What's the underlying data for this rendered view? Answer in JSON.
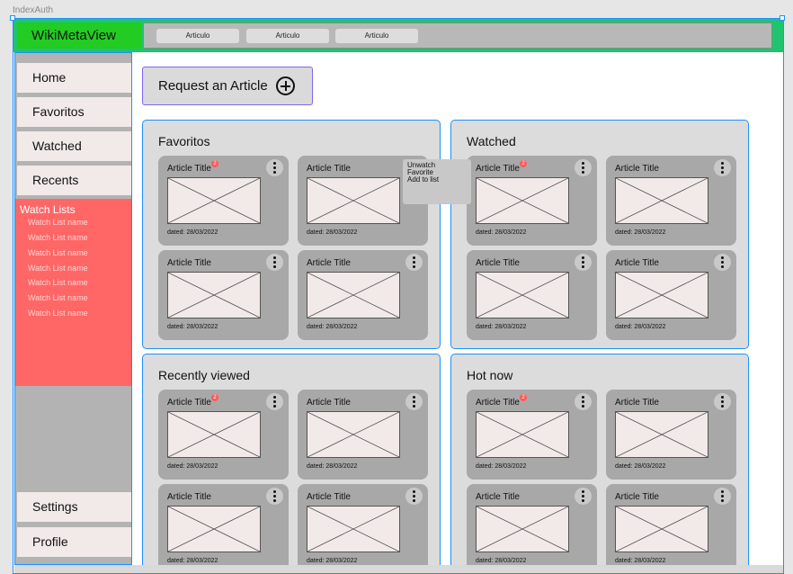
{
  "frame_label": "IndexAuth",
  "header": {
    "brand": "WikiMetaView",
    "tabs": [
      "Articulo",
      "Articulo",
      "Articulo"
    ]
  },
  "sidebar": {
    "nav": [
      "Home",
      "Favoritos",
      "Watched",
      "Recents"
    ],
    "watchlists": {
      "title": "Watch Lists",
      "items": [
        "Watch List name",
        "Watch List name",
        "Watch List name",
        "Watch List name",
        "Watch List name",
        "Watch List name",
        "Watch List name"
      ]
    },
    "bottom": [
      "Settings",
      "Profile"
    ]
  },
  "request_button": {
    "label": "Request an Article",
    "icon": "plus-circle-icon"
  },
  "sections": [
    {
      "title": "Favoritos",
      "cards": [
        {
          "title": "Article Title",
          "date": "dated: 28/03/2022",
          "badge": "2"
        },
        {
          "title": "Article Title",
          "date": "dated: 28/03/2022"
        },
        {
          "title": "Article Title",
          "date": "dated: 28/03/2022"
        },
        {
          "title": "Article Title",
          "date": "dated: 28/03/2022"
        }
      ]
    },
    {
      "title": "Watched",
      "cards": [
        {
          "title": "Article Title",
          "date": "dated: 28/03/2022",
          "badge": "2"
        },
        {
          "title": "Article Title",
          "date": "dated: 28/03/2022"
        },
        {
          "title": "Article Title",
          "date": "dated: 28/03/2022"
        },
        {
          "title": "Article Title",
          "date": "dated: 28/03/2022"
        }
      ]
    },
    {
      "title": "Recently viewed",
      "cards": [
        {
          "title": "Article Title",
          "date": "dated: 28/03/2022",
          "badge": "2"
        },
        {
          "title": "Article Title",
          "date": "dated: 28/03/2022"
        },
        {
          "title": "Article Title",
          "date": "dated: 28/03/2022"
        },
        {
          "title": "Article Title",
          "date": "dated: 28/03/2022"
        }
      ]
    },
    {
      "title": "Hot now",
      "cards": [
        {
          "title": "Article Title",
          "date": "dated: 28/03/2022",
          "badge": "2"
        },
        {
          "title": "Article Title",
          "date": "dated: 28/03/2022"
        },
        {
          "title": "Article Title",
          "date": "dated: 28/03/2022"
        },
        {
          "title": "Article Title",
          "date": "dated: 28/03/2022"
        }
      ]
    }
  ],
  "context_menu": [
    "Unwatch",
    "Favorite",
    "Add to list"
  ],
  "colors": {
    "topbar": "#1fc46e",
    "brand": "#22cc22",
    "watchlists": "#ff6666",
    "selection": "#1e90ff",
    "badge": "#ff5a5a"
  }
}
